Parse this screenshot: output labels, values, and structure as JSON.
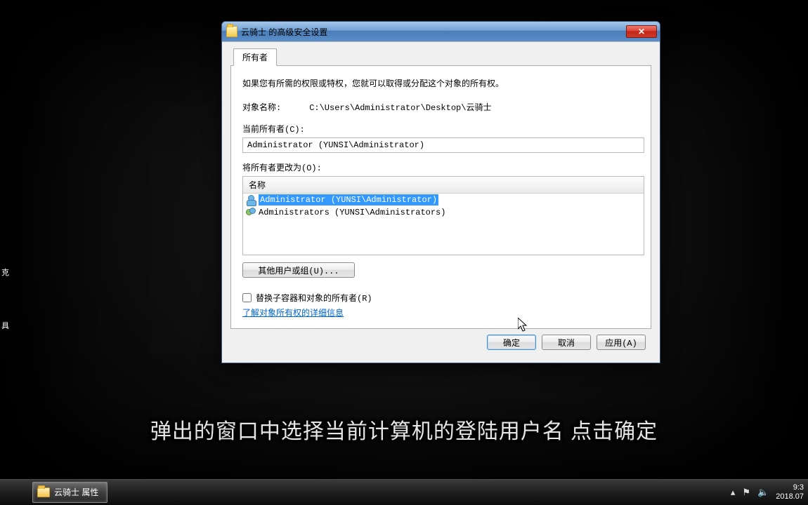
{
  "dialog": {
    "title": "云骑士 的高级安全设置",
    "tab_label": "所有者",
    "intro": "如果您有所需的权限或特权，您就可以取得或分配这个对象的所有权。",
    "object_name_label": "对象名称:",
    "object_name_value": "C:\\Users\\Administrator\\Desktop\\云骑士",
    "current_owner_label": "当前所有者(C):",
    "current_owner_value": "Administrator (YUNSI\\Administrator)",
    "change_owner_label": "将所有者更改为(O):",
    "list_header": "名称",
    "owners": [
      {
        "name": "Administrator (YUNSI\\Administrator)",
        "selected": true,
        "type": "single"
      },
      {
        "name": "Administrators (YUNSI\\Administrators)",
        "selected": false,
        "type": "group"
      }
    ],
    "other_users_button": "其他用户或组(U)...",
    "replace_checkbox_label": "替换子容器和对象的所有者(R)",
    "replace_checked": false,
    "learn_more_link": "了解对象所有权的详细信息",
    "ok_button": "确定",
    "cancel_button": "取消",
    "apply_button": "应用(A)"
  },
  "subtitle": "弹出的窗口中选择当前计算机的登陆用户名 点击确定",
  "taskbar": {
    "task_label": "云骑士 属性",
    "time": "9:3",
    "date": "2018.07"
  },
  "desktop_labels": {
    "a": "克",
    "b": "具"
  }
}
